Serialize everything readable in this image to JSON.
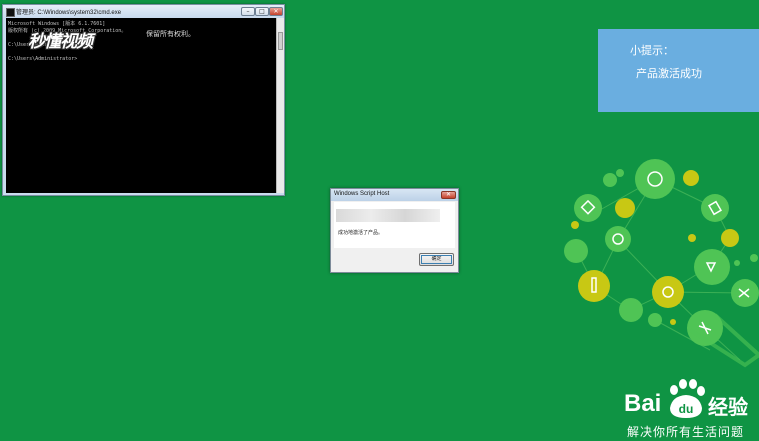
{
  "cmd": {
    "title": "管理员: C:\\Windows\\system32\\cmd.exe",
    "line1": "Microsoft Windows [版本 6.1.7601]",
    "line2": "版权所有 (c) 2009 Microsoft Corporation。",
    "line2b": "保留所有权利。",
    "line3": "C:\\Users\\Administrator>",
    "line4": "C:\\Users\\Administrator>",
    "watermark": "秒懂视频",
    "min_icon": "minimize-icon",
    "max_icon": "maximize-icon",
    "close_icon": "close-icon"
  },
  "dialog": {
    "title": "Windows Script Host",
    "message": "成功地激活了产品。",
    "ok_label": "确定"
  },
  "tip": {
    "label": "小提示：",
    "message": "产品激活成功"
  },
  "baidu": {
    "brand_bai": "Bai",
    "brand_du": "du",
    "jingyan": "经验",
    "slogan": "解决你所有生活问题"
  },
  "colors": {
    "background": "#0f9444",
    "tip_box": "#6aaee0",
    "deco_green": "#4fc455",
    "deco_yellow": "#c8c814"
  }
}
